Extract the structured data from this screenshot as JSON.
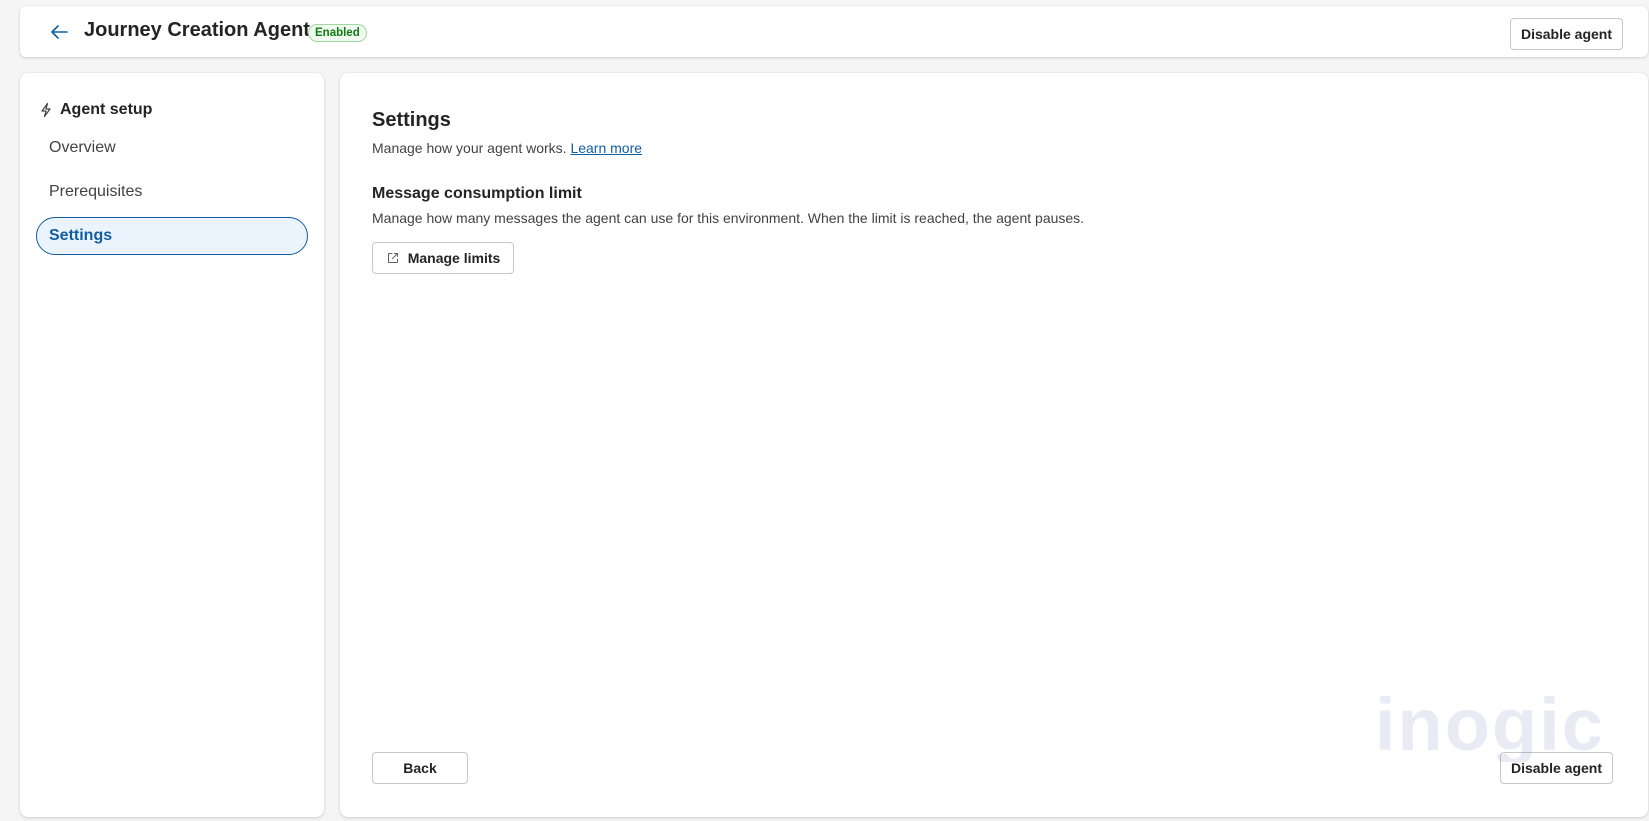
{
  "header": {
    "title": "Journey Creation Agent",
    "status": "Enabled",
    "disable_label": "Disable agent"
  },
  "sidebar": {
    "heading": "Agent setup",
    "heading_icon": "flash-icon",
    "items": [
      {
        "label": "Overview",
        "active": false
      },
      {
        "label": "Prerequisites",
        "active": false
      },
      {
        "label": "Settings",
        "active": true
      }
    ]
  },
  "main": {
    "title": "Settings",
    "description": "Manage how your agent works.",
    "learn_more": "Learn more",
    "section": {
      "title": "Message consumption limit",
      "description": "Manage how many messages the agent can use for this environment. When the limit is reached, the agent pauses.",
      "button_label": "Manage limits",
      "button_icon": "open-external-icon"
    },
    "back_label": "Back",
    "disable_label": "Disable agent"
  },
  "watermark": "inogic",
  "colors": {
    "accent": "#115ea3",
    "success": "#107c10",
    "nav_active_bg": "#ebf3fc"
  }
}
